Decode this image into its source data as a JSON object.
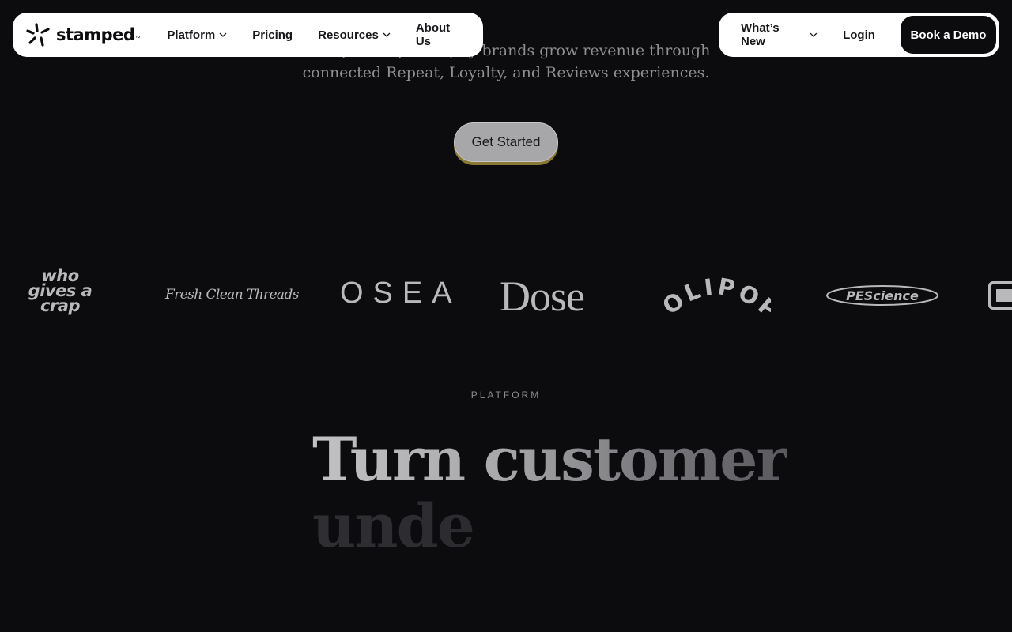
{
  "nav": {
    "brand": "stamped",
    "brand_tm": "™",
    "items": [
      {
        "label": "Platform",
        "dropdown": true
      },
      {
        "label": "Pricing",
        "dropdown": false
      },
      {
        "label": "Resources",
        "dropdown": true
      },
      {
        "label": "About Us",
        "dropdown": false
      }
    ],
    "right_items": [
      {
        "label": "What’s New",
        "dropdown": true
      },
      {
        "label": "Login",
        "dropdown": false
      }
    ],
    "demo_label": "Book a Demo"
  },
  "hero": {
    "subtitle_line1": "Stamped helps Shopify brands grow revenue through",
    "subtitle_line2": "connected Repeat, Loyalty, and Reviews experiences.",
    "cta_label": "Get Started"
  },
  "logos": {
    "wgac_1": "who",
    "wgac_2": "gives a",
    "wgac_3": "crap",
    "fresh_clean_threads": "Fresh Clean Threads",
    "osea": "OSEA",
    "dose": "Dose",
    "olipop": "OLIPOP",
    "pescience": "PEScience"
  },
  "platform": {
    "eyebrow": "PLATFORM",
    "headline_line1": "Turn customer",
    "headline_line2": "unde"
  },
  "colors": {
    "background": "#0c0c0e",
    "nav_bg": "#ffffff",
    "cta_bg": "#a7a7aa",
    "cta_shadow": "#8a7a35"
  }
}
